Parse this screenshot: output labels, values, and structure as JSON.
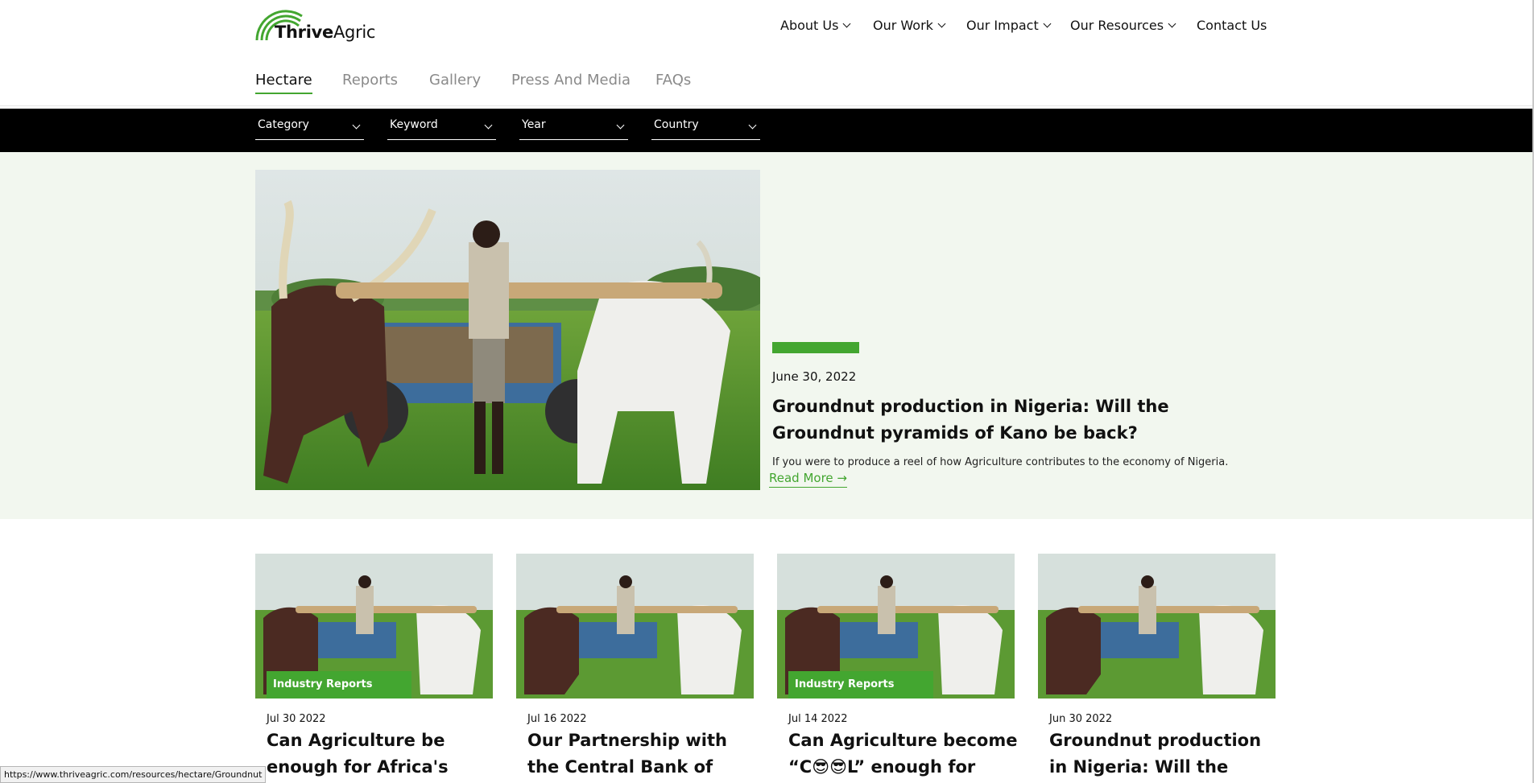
{
  "brand": {
    "part1": "Thrive",
    "part2": "Agric",
    "color": "#43a630"
  },
  "main_nav": [
    {
      "label": "About Us",
      "has_dropdown": true
    },
    {
      "label": "Our Work",
      "has_dropdown": true
    },
    {
      "label": "Our Impact",
      "has_dropdown": true
    },
    {
      "label": "Our Resources",
      "has_dropdown": true
    },
    {
      "label": "Contact Us",
      "has_dropdown": false
    }
  ],
  "sub_nav": [
    {
      "label": "Hectare",
      "active": true
    },
    {
      "label": "Reports",
      "active": false
    },
    {
      "label": "Gallery",
      "active": false
    },
    {
      "label": "Press And Media",
      "active": false
    },
    {
      "label": "FAQs",
      "active": false
    }
  ],
  "filters": [
    {
      "label": "Category"
    },
    {
      "label": "Keyword"
    },
    {
      "label": "Year"
    },
    {
      "label": "Country"
    }
  ],
  "featured": {
    "date": "June 30, 2022",
    "title": "Groundnut production in Nigeria: Will the Groundnut pyramids of Kano be back?",
    "excerpt": "If you were to produce a reel of how Agriculture contributes to the economy of Nigeria.",
    "read_more": "Read More →"
  },
  "cards": [
    {
      "badge": "Industry Reports",
      "date": "Jul 30 2022",
      "title": "Can Agriculture be enough for Africa's"
    },
    {
      "badge": "",
      "date": "Jul 16 2022",
      "title": "Our Partnership with the Central Bank of Nigeria"
    },
    {
      "badge": "Industry Reports",
      "date": "Jul 14 2022",
      "title": "Can Agriculture become “C😎😎L” enough for"
    },
    {
      "badge": "",
      "date": "Jun 30 2022",
      "title": "Groundnut production in Nigeria: Will the"
    }
  ],
  "status_url": "https://www.thriveagric.com/resources/hectare/Groundnut"
}
